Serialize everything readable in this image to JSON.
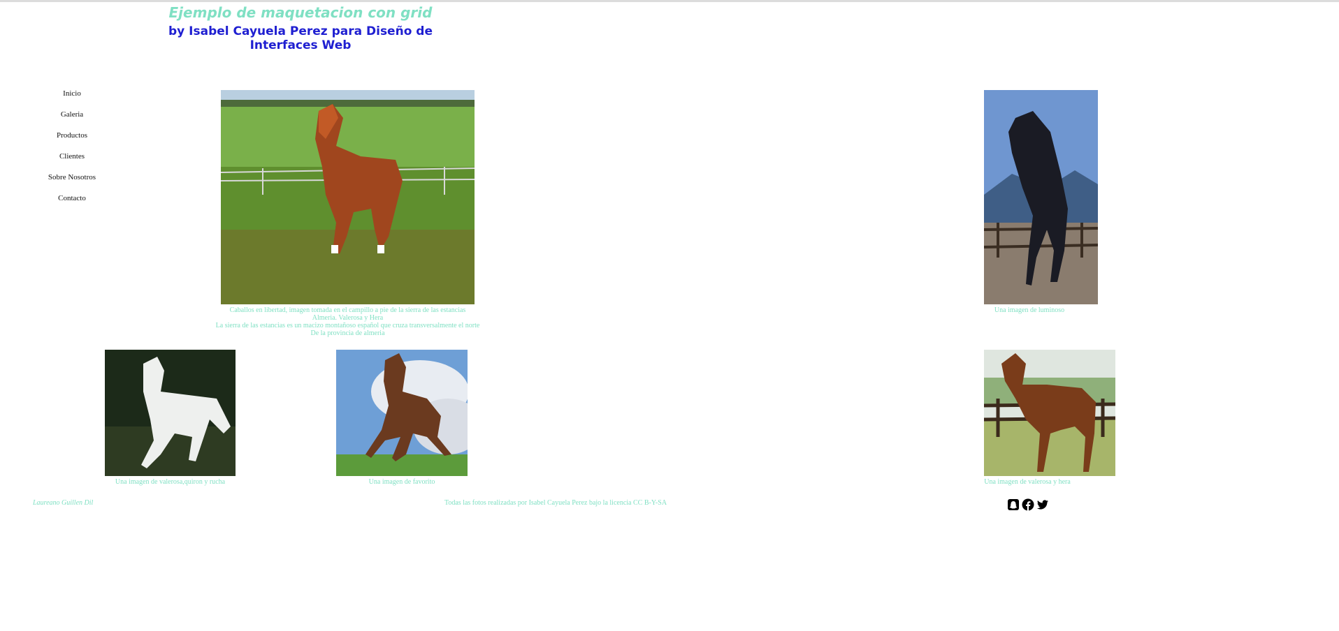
{
  "header": {
    "title": "Ejemplo de maquetacion con grid",
    "subtitle": "by Isabel Cayuela Perez para Diseño de Interfaces Web"
  },
  "nav": {
    "items": [
      "Inicio",
      "Galeria",
      "Productos",
      "Clientes",
      "Sobre Nosotros",
      "Contacto"
    ]
  },
  "gallery": {
    "main_caption": {
      "line1": "Caballos en libertad, imagen tomada en el campillo a pie de la sierra de las estancias",
      "line2": "Almeria. Valerosa y Hera",
      "line3": "La sierra de las estancias es un macizo montañoso español que cruza transversalmente el norte",
      "line4": "De la provincia de almeria"
    },
    "caption_black": "Una imagen de luminoso",
    "caption_white": "Una imagen de valerosa,quiron y rucha",
    "caption_running": "Una imagen de favorito",
    "caption_bay": "Una imagen de valerosa y hera"
  },
  "footer": {
    "author": "Laureano Guillen Dil",
    "license": "Todas las fotos realizadas por Isabel Cayuela Perez bajo la licencia CC B-Y-SA"
  },
  "social": {
    "icons": [
      "snapchat-icon",
      "facebook-icon",
      "twitter-icon"
    ]
  },
  "colors": {
    "accent": "#7fe0c3",
    "subtitle": "#1f1fd1"
  }
}
